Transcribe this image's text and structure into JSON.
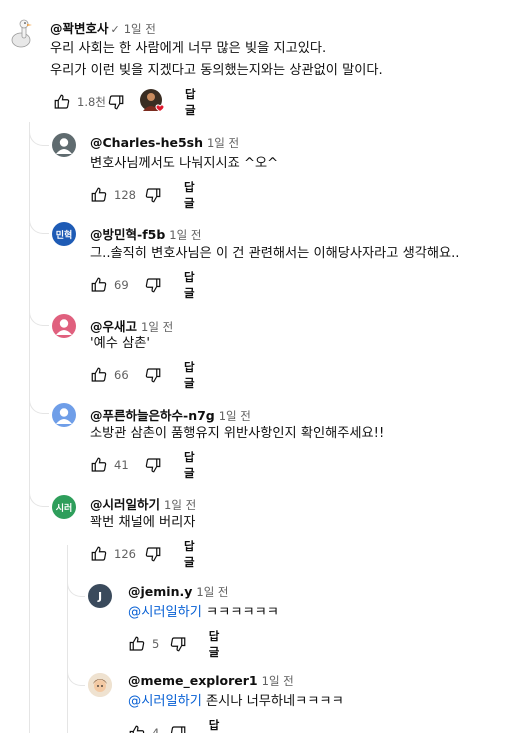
{
  "root": {
    "author": "@꽉변호사",
    "time": "1일 전",
    "text_line1": "우리 사회는 한 사람에게 너무 많은 빚을 지고있다.",
    "text_line2": "우리가 이런 빚을 지겠다고 동의했는지와는 상관없이 말이다.",
    "likes": "1.8천",
    "reply_label": "답글"
  },
  "replies": [
    {
      "author": "@Charles-he5sh",
      "time": "1일 전",
      "text": "변호사님께서도 나눠지시죠 ^오^",
      "likes": "128",
      "reply_label": "답글",
      "avatar_color": "#5f6b6f"
    },
    {
      "author": "@방민혁-f5b",
      "time": "1일 전",
      "avatar_text": "민혁",
      "text": "그..솔직히 변호사님은 이 건 관련해서는 이해당사자라고 생각해요..",
      "likes": "69",
      "reply_label": "답글",
      "avatar_color": "#1e5bb5"
    },
    {
      "author": "@우새고",
      "time": "1일 전",
      "text": "'예수 삼촌'",
      "likes": "66",
      "reply_label": "답글",
      "avatar_color": "#e0607e"
    },
    {
      "author": "@푸른하늘은하수-n7g",
      "time": "1일 전",
      "text": "소방관 삼촌이 품행유지 위반사항인지 확인해주세요!!",
      "likes": "41",
      "reply_label": "답글",
      "avatar_color": "#6f9ee8"
    },
    {
      "author": "@시러일하기",
      "time": "1일 전",
      "avatar_text": "시러",
      "text": "꽉번 채널에 버리자",
      "likes": "126",
      "reply_label": "답글",
      "avatar_color": "#2e9e5b"
    }
  ],
  "nested": [
    {
      "author": "@jemin.y",
      "time": "1일 전",
      "mention": "@시러일하기",
      "text": " ㅋㅋㅋㅋㅋㅋ",
      "likes": "5",
      "reply_label": "답글",
      "avatar_text": "J",
      "avatar_color": "#3a4a5c"
    },
    {
      "author": "@meme_explorer1",
      "time": "1일 전",
      "mention": "@시러일하기",
      "text": " 존시나 너무하네ㅋㅋㅋㅋ",
      "likes": "4",
      "reply_label": "답글"
    }
  ],
  "colors": {
    "link": "#065fd4",
    "secondary": "#606060",
    "thread": "#e5e5e5"
  },
  "icons": [
    "like-icon",
    "dislike-icon",
    "creator-heart-icon",
    "checkmark-icon"
  ]
}
